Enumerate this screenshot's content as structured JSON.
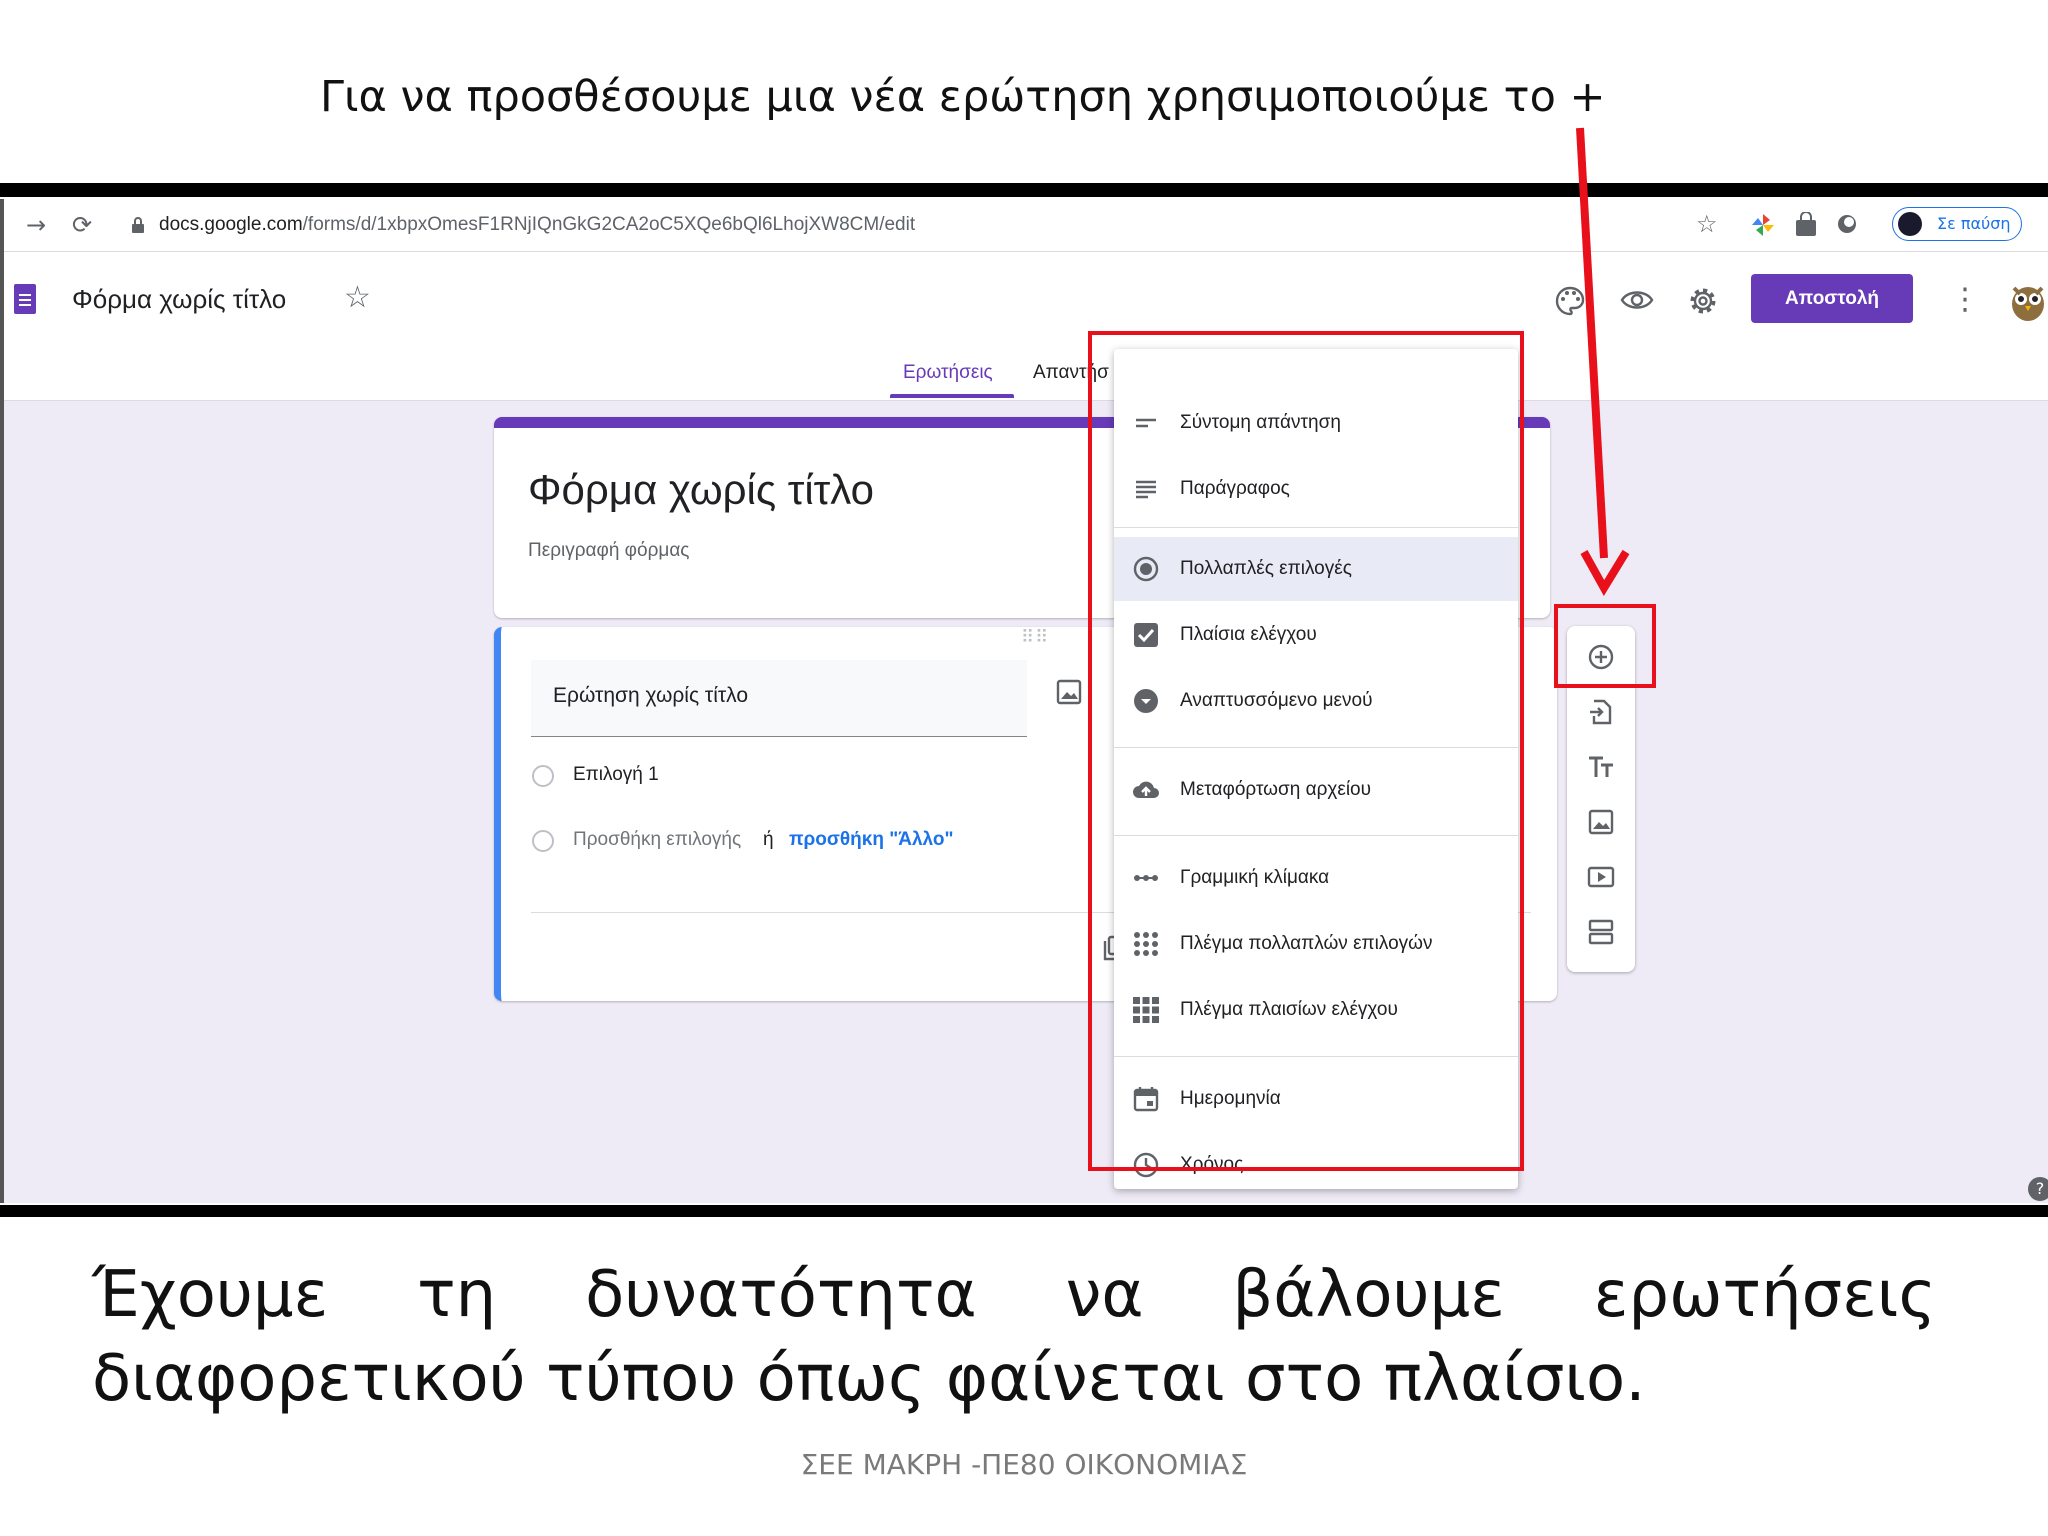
{
  "slide": {
    "top_caption": "Για να προσθέσουμε μια νέα ερώτηση χρησιμοποιούμε το  +",
    "bottom_text": "Έχουμε τη δυνατότητα να βάλουμε ερωτήσεις διαφορετικού τύπου όπως φαίνεται στο πλαίσιο.",
    "footer": "ΣΕΕ ΜΑΚΡΗ -ΠΕ80 ΟΙΚΟΝΟΜΙΑΣ"
  },
  "browser": {
    "url_host": "docs.google.com",
    "url_path": "/forms/d/1xbpxOmesF1RNjIQnGkG2CA2oC5XQe6bQl6LhojXW8CM/edit",
    "pause_label": "Σε παύση"
  },
  "header": {
    "doc_title": "Φόρμα χωρίς τίτλο",
    "send_label": "Αποστολή",
    "tabs": [
      "Ερωτήσεις",
      "Απαντήσ"
    ]
  },
  "form": {
    "title": "Φόρμα χωρίς τίτλο",
    "description_placeholder": "Περιγραφή φόρμας",
    "question": {
      "title": "Ερώτηση χωρίς τίτλο",
      "option1": "Επιλογή 1",
      "add_option": "Προσθήκη επιλογής",
      "or": "ή",
      "add_other": "προσθήκη \"Άλλο\""
    }
  },
  "menu": {
    "items": [
      {
        "label": "Σύντομη απάντηση",
        "icon": "short-text-icon"
      },
      {
        "label": "Παράγραφος",
        "icon": "paragraph-icon"
      },
      {
        "label": "Πολλαπλές επιλογές",
        "icon": "radio-button-icon",
        "selected": true
      },
      {
        "label": "Πλαίσια ελέγχου",
        "icon": "checkbox-icon"
      },
      {
        "label": "Αναπτυσσόμενο μενού",
        "icon": "dropdown-icon"
      },
      {
        "label": "Μεταφόρτωση αρχείου",
        "icon": "cloud-upload-icon"
      },
      {
        "label": "Γραμμική κλίμακα",
        "icon": "linear-scale-icon"
      },
      {
        "label": "Πλέγμα πολλαπλών επιλογών",
        "icon": "radio-grid-icon"
      },
      {
        "label": "Πλέγμα πλαισίων ελέγχου",
        "icon": "checkbox-grid-icon"
      },
      {
        "label": "Ημερομηνία",
        "icon": "calendar-icon"
      },
      {
        "label": "Χρόνος",
        "icon": "clock-icon"
      }
    ]
  },
  "toolbar_icons": [
    "add-question-icon",
    "import-questions-icon",
    "add-title-icon",
    "add-image-icon",
    "add-video-icon",
    "add-section-icon"
  ],
  "colors": {
    "accent": "#673ab7",
    "annotation_red": "#e8101a",
    "question_border": "#4285f4",
    "form_bg": "#eeeaf6"
  }
}
